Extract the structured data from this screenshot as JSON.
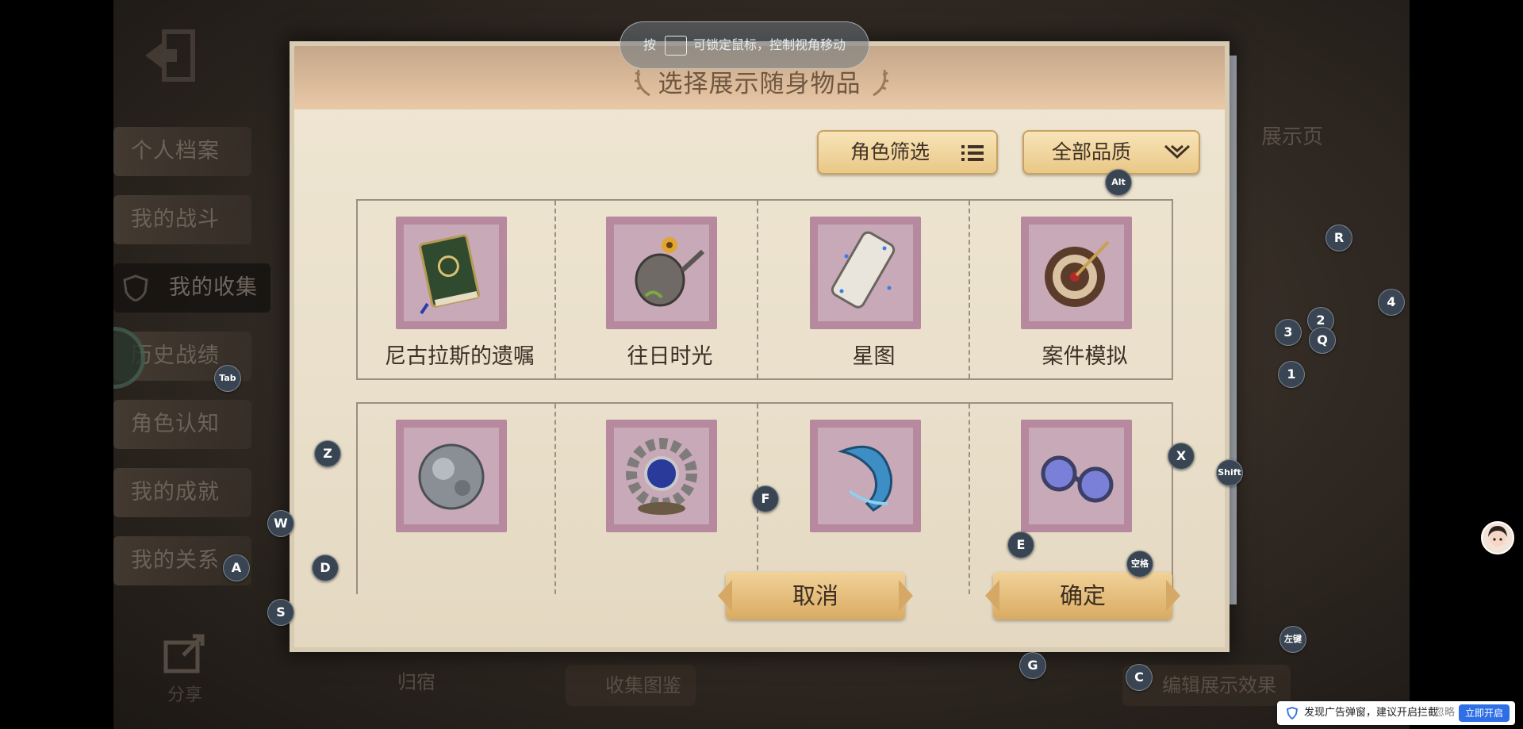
{
  "side_menu": {
    "items": [
      {
        "label": "个人档案"
      },
      {
        "label": "我的战斗"
      },
      {
        "label": "我的收集"
      },
      {
        "label": "历史战绩"
      },
      {
        "label": "角色认知"
      },
      {
        "label": "我的成就"
      },
      {
        "label": "我的关系"
      }
    ]
  },
  "share": {
    "label": "分享"
  },
  "right_panel": {
    "label": "展示页"
  },
  "bottom": {
    "back_label": "归宿",
    "collection_label": "收集图鉴",
    "edit_label": "编辑展示效果"
  },
  "dialog": {
    "title": "选择展示随身物品",
    "filter_label": "角色筛选",
    "quality_label": "全部品质",
    "items_row1": [
      {
        "name": "尼古拉斯的遗嘱",
        "icon": "book-icon"
      },
      {
        "name": "往日时光",
        "icon": "watering-can-icon"
      },
      {
        "name": "星图",
        "icon": "star-map-icon"
      },
      {
        "name": "案件模拟",
        "icon": "dartboard-icon"
      }
    ],
    "items_row2": [
      {
        "name": "",
        "icon": "moon-orb-icon"
      },
      {
        "name": "",
        "icon": "gear-gem-icon"
      },
      {
        "name": "",
        "icon": "dolphin-icon"
      },
      {
        "name": "",
        "icon": "goggles-icon"
      }
    ],
    "cancel_label": "取消",
    "confirm_label": "确定"
  },
  "lock_tip": {
    "prefix": "按",
    "text": "可锁定鼠标，控制视角移动"
  },
  "key_hints": {
    "alt": "Alt",
    "r": "R",
    "two": "2",
    "four": "4",
    "three": "3",
    "q": "Q",
    "one": "1",
    "tab": "Tab",
    "z": "Z",
    "x": "X",
    "shift": "Shift",
    "f": "F",
    "w": "W",
    "e": "E",
    "space": "空格",
    "a": "A",
    "d": "D",
    "s": "S",
    "left_click": "左键",
    "g": "G",
    "c": "C"
  },
  "ad_bar": {
    "message": "发现广告弹窗，建议开启拦截",
    "ignore": "忽略",
    "open": "立即开启"
  },
  "colors": {
    "dialog_paper": "#ece3cf",
    "stamp": "#b6899e",
    "button_gold": "#e9c886",
    "key_hint_bg": "#3a4553",
    "ad_blue": "#2f6fe6"
  }
}
